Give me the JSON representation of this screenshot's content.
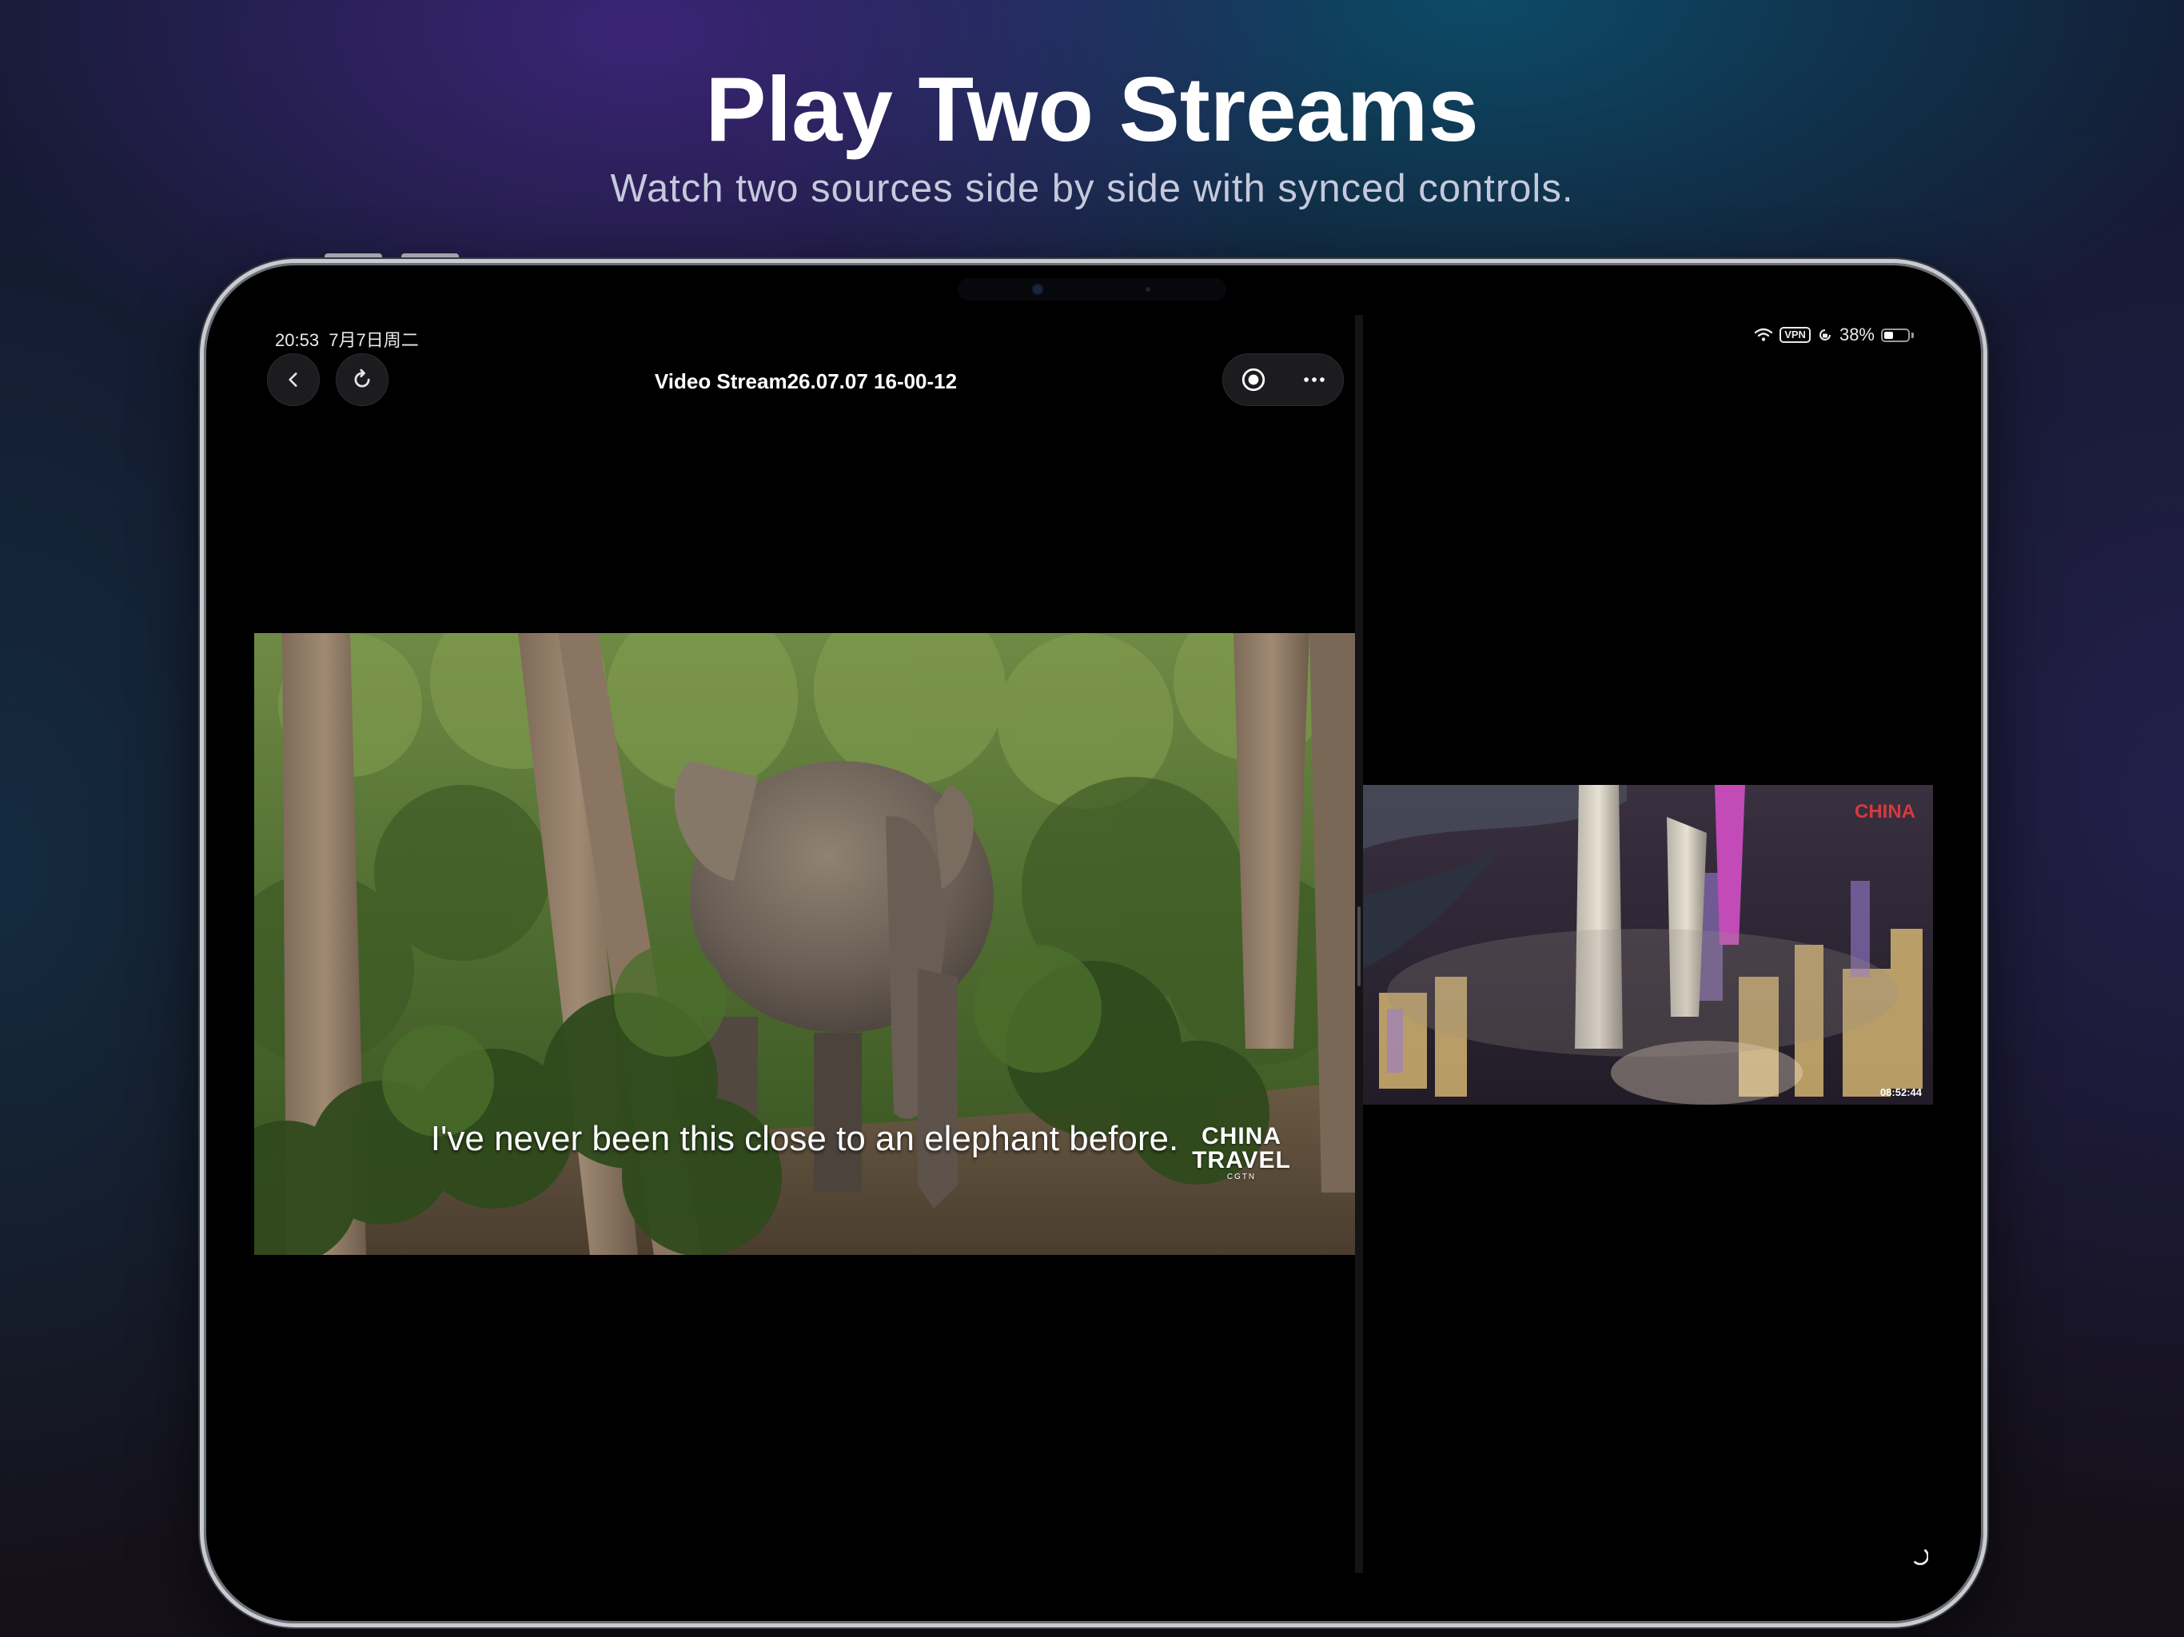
{
  "hero": {
    "title": "Play Two Streams",
    "subtitle": "Watch two sources side by side with synced controls."
  },
  "status_bar": {
    "time": "20:53",
    "date": "7月7日周二",
    "vpn": "VPN",
    "battery": "38%",
    "battery_level": 0.38
  },
  "player_left": {
    "title": "Video Stream26.07.07 16-00-12",
    "subtitle_text": "I've never been this close to an elephant before.",
    "logo_text_line1": "CHINA",
    "logo_text_line2": "TRAVEL",
    "logo_small": "CGTN"
  },
  "player_right": {
    "timecode": "08:52:44",
    "brand": "CHINA"
  },
  "colors": {
    "accent_white": "#ffffff",
    "screen_bg": "#000000",
    "control_bg": "#1c1c1f"
  },
  "icons": [
    "back-chevron-icon",
    "refresh-icon",
    "record-icon",
    "more-icon",
    "wifi-icon",
    "rotation-lock-icon",
    "battery-icon",
    "loading-spinner-icon"
  ]
}
